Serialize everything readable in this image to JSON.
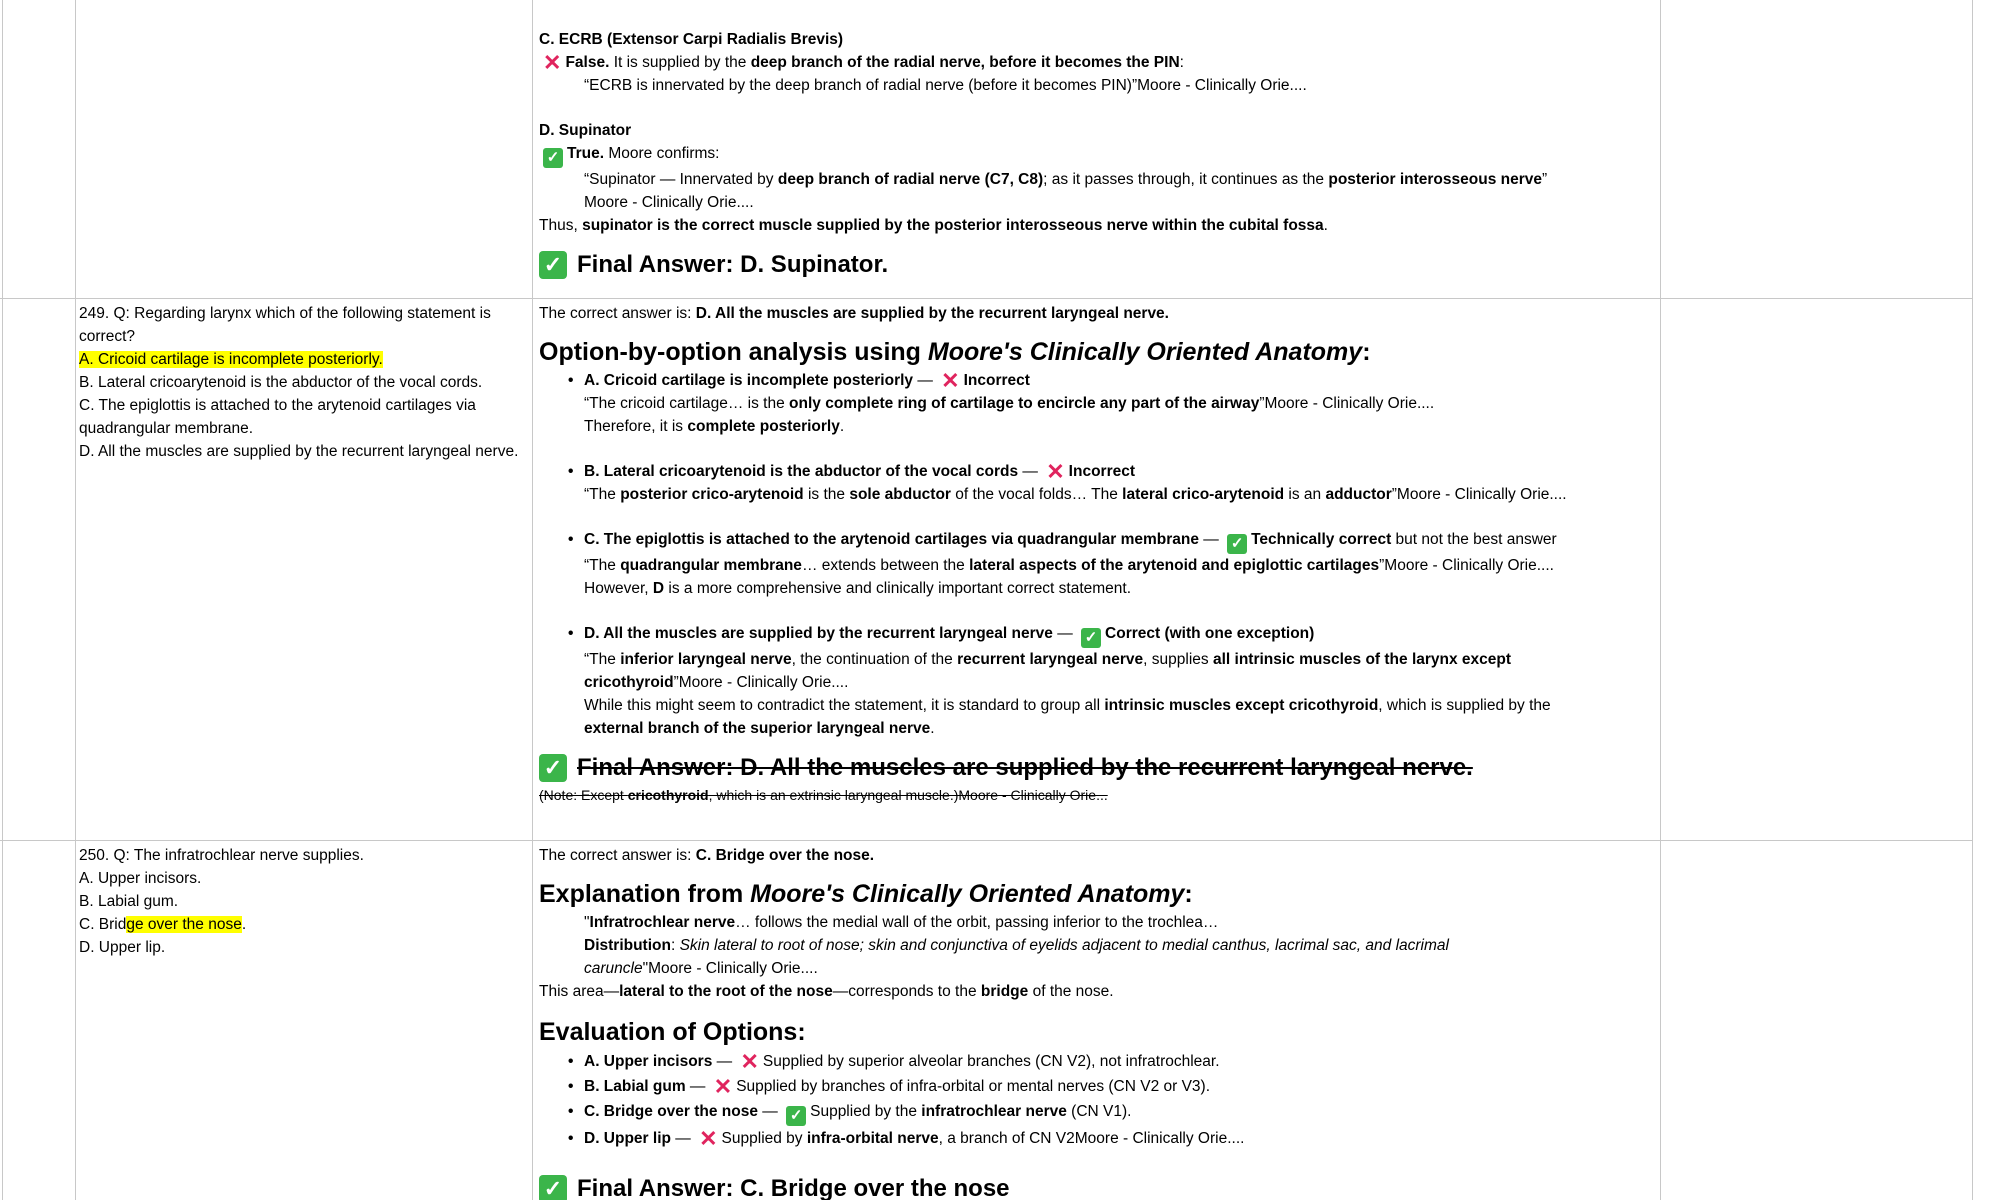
{
  "row248": {
    "c_title": "C. ECRB (Extensor Carpi Radialis Brevis)",
    "c_false": "False.",
    "c_text1": " It is supplied by the ",
    "c_bold1": "deep branch of the radial nerve, before it becomes the PIN",
    "c_text2": ":",
    "c_quote": "“ECRB is innervated by the deep branch of radial nerve (before it becomes PIN)”Moore - Clinically Orie....",
    "d_title": "D. Supinator",
    "d_true": "True.",
    "d_text1": " Moore confirms:",
    "d_q1": "“Supinator — Innervated by ",
    "d_q1b": "deep branch of radial nerve (C7, C8)",
    "d_q2": "; as it passes through, it continues as the ",
    "d_q2b": "posterior interosseous nerve",
    "d_q3": "”",
    "d_q4": "Moore - Clinically Orie....",
    "thus1": "Thus, ",
    "thus_b": "supinator is the correct muscle supplied by the posterior interosseous nerve within the cubital fossa",
    "thus2": ".",
    "final": "Final Answer: D. Supinator."
  },
  "row249": {
    "question": "249. Q: Regarding larynx which of the following statement is correct?",
    "opt_a": "A. Cricoid cartilage is incomplete posteriorly.",
    "opt_b": "B. Lateral cricoarytenoid is the abductor of the vocal cords.",
    "opt_c": "C. The epiglottis is attached to the arytenoid cartilages via quadrangular membrane.",
    "opt_d": "D. All the muscles are supplied by the recurrent laryngeal nerve.",
    "correct_pre": "The correct answer is: ",
    "correct_b": "D. All the muscles are supplied by the recurrent laryngeal nerve.",
    "heading_pre": "Option-by-option analysis using ",
    "heading_i": "Moore's Clinically Oriented Anatomy",
    "heading_post": ":",
    "a_title": "A. Cricoid cartilage is incomplete posteriorly",
    "a_dash": " — ",
    "a_verdict": "Incorrect",
    "a_q1": "“The cricoid cartilage… is the ",
    "a_q1b": "only complete ring of cartilage to encircle any part of the airway",
    "a_q1c": "”Moore - Clinically Orie....",
    "a_t1": "Therefore, it is ",
    "a_t1b": "complete posteriorly",
    "a_t1c": ".",
    "b_title": "B. Lateral cricoarytenoid is the abductor of the vocal cords",
    "b_verdict": "Incorrect",
    "b_q1": "“The ",
    "b_q1b": "posterior crico-arytenoid",
    "b_q2": " is the ",
    "b_q2b": "sole abductor",
    "b_q3": " of the vocal folds… The ",
    "b_q3b": "lateral crico-arytenoid",
    "b_q4": " is an ",
    "b_q4b": "adductor",
    "b_q5": "”Moore - Clinically Orie....",
    "c_title": "C. The epiglottis is attached to the arytenoid cartilages via quadrangular membrane",
    "c_verdict": "Technically correct",
    "c_verdict_post": " but not the best answer",
    "c_q1": "“The ",
    "c_q1b": "quadrangular membrane",
    "c_q2": "… extends between the ",
    "c_q2b": "lateral aspects of the arytenoid and epiglottic cartilages",
    "c_q3": "”Moore - Clinically Orie....",
    "c_t1": "However, ",
    "c_t1b": "D",
    "c_t1c": " is a more comprehensive and clinically important correct statement.",
    "d_title": "D. All the muscles are supplied by the recurrent laryngeal nerve",
    "d_verdict": "Correct (with one exception)",
    "d_q1": "“The ",
    "d_q1b": "inferior laryngeal nerve",
    "d_q2": ", the continuation of the ",
    "d_q2b": "recurrent laryngeal nerve",
    "d_q3": ", supplies ",
    "d_q3b": "all intrinsic muscles of the larynx except",
    "d_q4b": "cricothyroid",
    "d_q4": "”Moore - Clinically Orie....",
    "d_t1": "While this might seem to contradict the statement, it is standard to group all ",
    "d_t1b": "intrinsic muscles except cricothyroid",
    "d_t1c": ", which is supplied by the",
    "d_t2b": "external branch of the superior laryngeal nerve",
    "d_t2c": ".",
    "final": "Final Answer: D. All the muscles are supplied by the recurrent laryngeal nerve.",
    "note1": "(Note: Except ",
    "note_b": "cricothyroid",
    "note2": ", which is an extrinsic laryngeal muscle.)Moore - Clinically Orie..."
  },
  "row250": {
    "question": "250. Q: The infratrochlear nerve supplies.",
    "opt_a": "A. Upper incisors.",
    "opt_b": "B. Labial gum.",
    "opt_c_pre": "C. Brid",
    "opt_c_hl": "ge over the nose",
    "opt_c_post": ".",
    "opt_d": "D. Upper lip.",
    "correct_pre": "The correct answer is: ",
    "correct_b": "C. Bridge over the nose.",
    "heading_pre": "Explanation from ",
    "heading_i": "Moore's Clinically Oriented Anatomy",
    "heading_post": ":",
    "q1a": "\"",
    "q1b": "Infratrochlear nerve",
    "q1c": "… follows the medial wall of the orbit, passing inferior to the trochlea…",
    "q2b": "Distribution",
    "q2c": ": ",
    "q2i": "Skin lateral to root of nose; skin and conjunctiva of eyelids adjacent to medial canthus, lacrimal sac, and lacrimal",
    "q3i": "caruncle",
    "q3c": "\"Moore - Clinically Orie....",
    "area1": "This area—",
    "area_b": "lateral to the root of the nose",
    "area2": "—corresponds to the ",
    "area_b2": "bridge",
    "area3": " of the nose.",
    "eval_heading": "Evaluation of Options:",
    "e_a_b": "A. Upper incisors",
    "e_a_t": "Supplied by superior alveolar branches (CN V2), not infratrochlear.",
    "e_b_b": "B. Labial gum",
    "e_b_t": "Supplied by branches of infra-orbital or mental nerves (CN V2 or V3).",
    "e_c_b": "C. Bridge over the nose",
    "e_c_t1": "Supplied by the ",
    "e_c_tb": "infratrochlear nerve",
    "e_c_t2": " (CN V1).",
    "e_d_b": "D. Upper lip",
    "e_d_t1": "Supplied by ",
    "e_d_tb": "infra-orbital nerve",
    "e_d_t2": ", a branch of CN V2Moore - Clinically Orie....",
    "dash": " — ",
    "final": "Final Answer: C. Bridge over the nose"
  }
}
